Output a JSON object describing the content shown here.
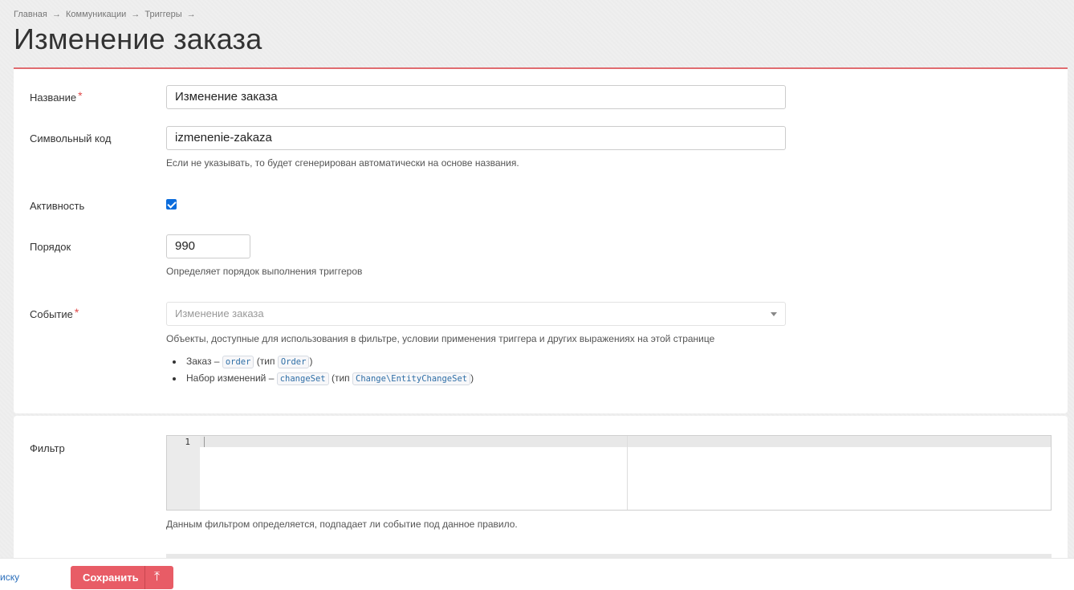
{
  "breadcrumb": {
    "items": [
      "Главная",
      "Коммуникации",
      "Триггеры"
    ],
    "separator": "→"
  },
  "page_title": "Изменение заказа",
  "form": {
    "name": {
      "label": "Название",
      "value": "Изменение заказа",
      "required": true
    },
    "code": {
      "label": "Символьный код",
      "value": "izmenenie-zakaza",
      "help": "Если не указывать, то будет сгенерирован автоматически на основе названия."
    },
    "active": {
      "label": "Активность",
      "checked": true
    },
    "order": {
      "label": "Порядок",
      "value": "990",
      "help": "Определяет порядок выполнения триггеров"
    },
    "event": {
      "label": "Событие",
      "required": true,
      "selected": "Изменение заказа",
      "help": "Объекты, доступные для использования в фильтре, условии применения триггера и других выражениях на этой странице",
      "objects": [
        {
          "title": "Заказ –",
          "var": "order",
          "type_prefix": "(тип",
          "type": "Order",
          "type_suffix": ")"
        },
        {
          "title": "Набор изменений –",
          "var": "changeSet",
          "type_prefix": "(тип",
          "type": "Change\\EntityChangeSet",
          "type_suffix": ")"
        }
      ]
    },
    "filter": {
      "label": "Фильтр",
      "line_number": "1",
      "help": "Данным фильтром определяется, подпадает ли событие под данное правило."
    }
  },
  "footer": {
    "back_link": "иску",
    "save_button": "Сохранить",
    "save_arrow": "⤒"
  },
  "colors": {
    "accent": "#e85c66",
    "link": "#2a6ebb",
    "checkbox": "#0b6cdc"
  }
}
